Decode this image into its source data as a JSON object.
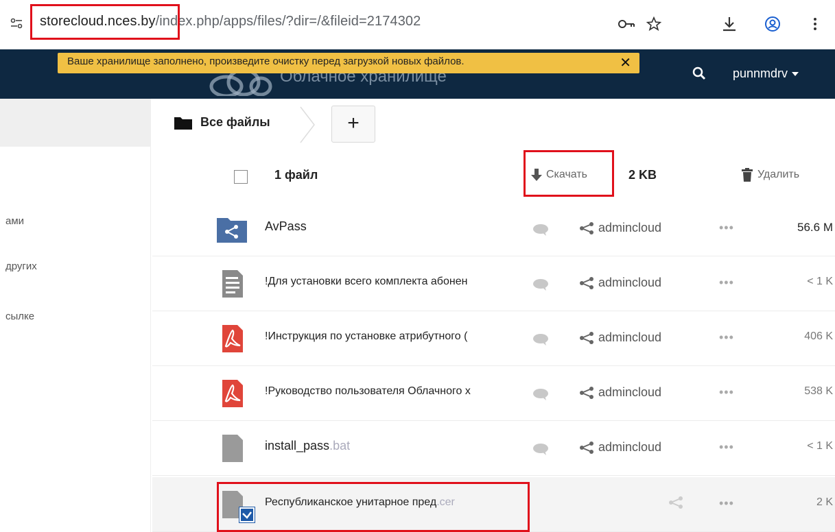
{
  "browser": {
    "url_host": "storecloud.nces.by",
    "url_path": "/index.php/apps/files/?dir=/&fileid=2174302",
    "icons": [
      "site-info-icon",
      "password-key-icon",
      "bookmark-star-icon",
      "download-icon",
      "profile-icon",
      "menu-icon"
    ]
  },
  "header": {
    "brand_title": "Облачное хранилище",
    "user": "punnmdrv",
    "warning": "Ваше хранилище заполнено, произведите очистку перед загрузкой новых файлов.",
    "warning_close": "✕",
    "colors": {
      "header_bg": "#0e2841",
      "warning_bg": "#f0c044",
      "highlight": "#e0101b"
    }
  },
  "sidebar": {
    "items": [
      {
        "label": "ами"
      },
      {
        "label": "других"
      },
      {
        "label": "сылке"
      }
    ]
  },
  "breadcrumb": {
    "root_label": "Все файлы",
    "add_label": "+"
  },
  "selection": {
    "count_label": "1 файл",
    "download_label": "Скачать",
    "size_label": "2 KB",
    "delete_label": "Удалить"
  },
  "files": [
    {
      "name": "AvPass",
      "ext": "",
      "type": "shared-folder",
      "owner": "admincloud",
      "size": "56.6 M",
      "more": "•••"
    },
    {
      "name": "!Для установки всего комплекта абонен",
      "ext": "",
      "type": "text",
      "owner": "admincloud",
      "size": "< 1 K",
      "more": "•••"
    },
    {
      "name": "!Инструкция по установке атрибутного (",
      "ext": "",
      "type": "pdf",
      "owner": "admincloud",
      "size": "406 K",
      "more": "•••"
    },
    {
      "name": "!Руководство пользователя Облачного х",
      "ext": "",
      "type": "pdf",
      "owner": "admincloud",
      "size": "538 K",
      "more": "•••"
    },
    {
      "name": "install_pass",
      "ext": ".bat",
      "type": "file",
      "owner": "admincloud",
      "size": "< 1 K",
      "more": "•••"
    },
    {
      "name": "Республиканское унитарное пред",
      "ext": ".cer",
      "type": "file",
      "owner": "",
      "size": "2 K",
      "more": "•••",
      "selected": true
    }
  ]
}
